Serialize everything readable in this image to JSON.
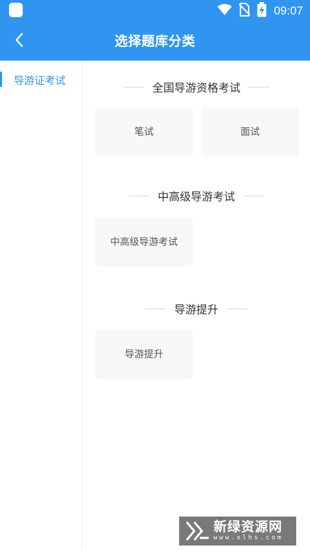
{
  "status_bar": {
    "time": "09:07",
    "icons": [
      "app-icon",
      "wifi-icon",
      "no-sim-icon",
      "battery-charging-icon"
    ]
  },
  "header": {
    "title": "选择题库分类",
    "back_icon": "back-arrow-icon",
    "background_color": "#2f95f0"
  },
  "sidebar": {
    "items": [
      {
        "label": "导游证考试",
        "active": true
      }
    ]
  },
  "sections": [
    {
      "title": "全国导游资格考试",
      "cards": [
        "笔试",
        "面试"
      ]
    },
    {
      "title": "中高级导游考试",
      "cards": [
        "中高级导游考试"
      ]
    },
    {
      "title": "导游提升",
      "cards": [
        "导游提升"
      ]
    }
  ],
  "watermark": {
    "name": "新绿资源网",
    "url": "www.xlhs.com"
  },
  "colors": {
    "accent": "#2f95f0",
    "card_background": "#f8f8f8",
    "text_primary": "#333333"
  }
}
